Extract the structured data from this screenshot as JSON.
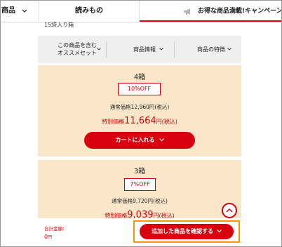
{
  "nav": {
    "category_label": "商品",
    "reading_label": "読みもの",
    "campaign_label": "お得な商品満載!キャンペーン"
  },
  "product": {
    "contents_label": "15袋入り箱"
  },
  "tabs": [
    {
      "line1": "この商品を含む",
      "line2": "オススメセット"
    },
    {
      "label": "商品情報"
    },
    {
      "label": "商品の特徴"
    }
  ],
  "sets": [
    {
      "title": "4箱",
      "discount": "10%OFF",
      "regular_price": "通常価格12,960円(税込)",
      "special_label": "特別価格",
      "special_price": "11,664",
      "special_unit": "円(税込)",
      "cart_button": "カートに入れる"
    },
    {
      "title": "3箱",
      "discount": "7%OFF",
      "regular_price": "通常価格9,720円(税込)",
      "special_label": "特別価格",
      "special_price": "9,039",
      "special_unit": "円(税込)"
    }
  ],
  "footer": {
    "total_label": "合計金額：",
    "total_value": "0",
    "total_unit": "円",
    "confirm_button": "追加した商品を確認する"
  },
  "colors": {
    "accent_red": "#d8000f",
    "card_bg": "#fce6c9",
    "highlight_outline": "#f39800"
  }
}
